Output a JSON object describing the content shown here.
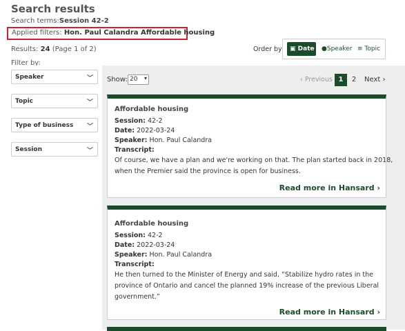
{
  "header": {
    "title": "Search results",
    "search_terms_label": "Search terms:",
    "search_terms_value": "Session 42-2",
    "applied_filters_label": "Applied filters:",
    "applied_filters_value": "Hon. Paul Calandra Affordable housing",
    "results_label": "Results:",
    "results_count": "24",
    "results_page": "(Page 1 of 2)"
  },
  "order_by": {
    "label": "Order by:",
    "buttons": [
      {
        "label": "Date",
        "icon": "calendar-icon",
        "active": true
      },
      {
        "label": "Speaker",
        "icon": "person-icon",
        "active": false
      },
      {
        "label": "Topic",
        "icon": "list-icon",
        "active": false
      }
    ]
  },
  "sidebar": {
    "filter_by_label": "Filter by:",
    "filters": [
      "Speaker",
      "Topic",
      "Type of business",
      "Session"
    ]
  },
  "pagination": {
    "show_label": "Show:",
    "show_value": "20",
    "previous_label": "‹ Previous",
    "pages": [
      "1",
      "2"
    ],
    "current_page": "1",
    "next_label": "Next ›"
  },
  "cards": [
    {
      "title": "Affordable housing",
      "session_label": "Session:",
      "session": "42-2",
      "date_label": "Date:",
      "date": "2022-03-24",
      "speaker_label": "Speaker:",
      "speaker": "Hon. Paul Calandra",
      "transcript_label": "Transcript:",
      "transcript_lines": [
        "Of course, we have a plan and we're working on that. The plan started back in 2018,",
        "when the Premier said the province is open for business."
      ],
      "read_more": "Read more in Hansard ›"
    },
    {
      "title": "Affordable housing",
      "session_label": "Session:",
      "session": "42-2",
      "date_label": "Date:",
      "date": "2022-03-24",
      "speaker_label": "Speaker:",
      "speaker": "Hon. Paul Calandra",
      "transcript_label": "Transcript:",
      "transcript_lines": [
        "He then turned to the Minister of Energy and said, “Stabilize hydro rates in the",
        "province of Ontario and cancel the planned 19% increase of the previous Liberal",
        "government.”"
      ],
      "read_more": "Read more in Hansard ›"
    }
  ],
  "colors": {
    "accent": "#1c4b2a",
    "highlight_border": "#d0202e",
    "panel_bg": "#eeeeee"
  }
}
